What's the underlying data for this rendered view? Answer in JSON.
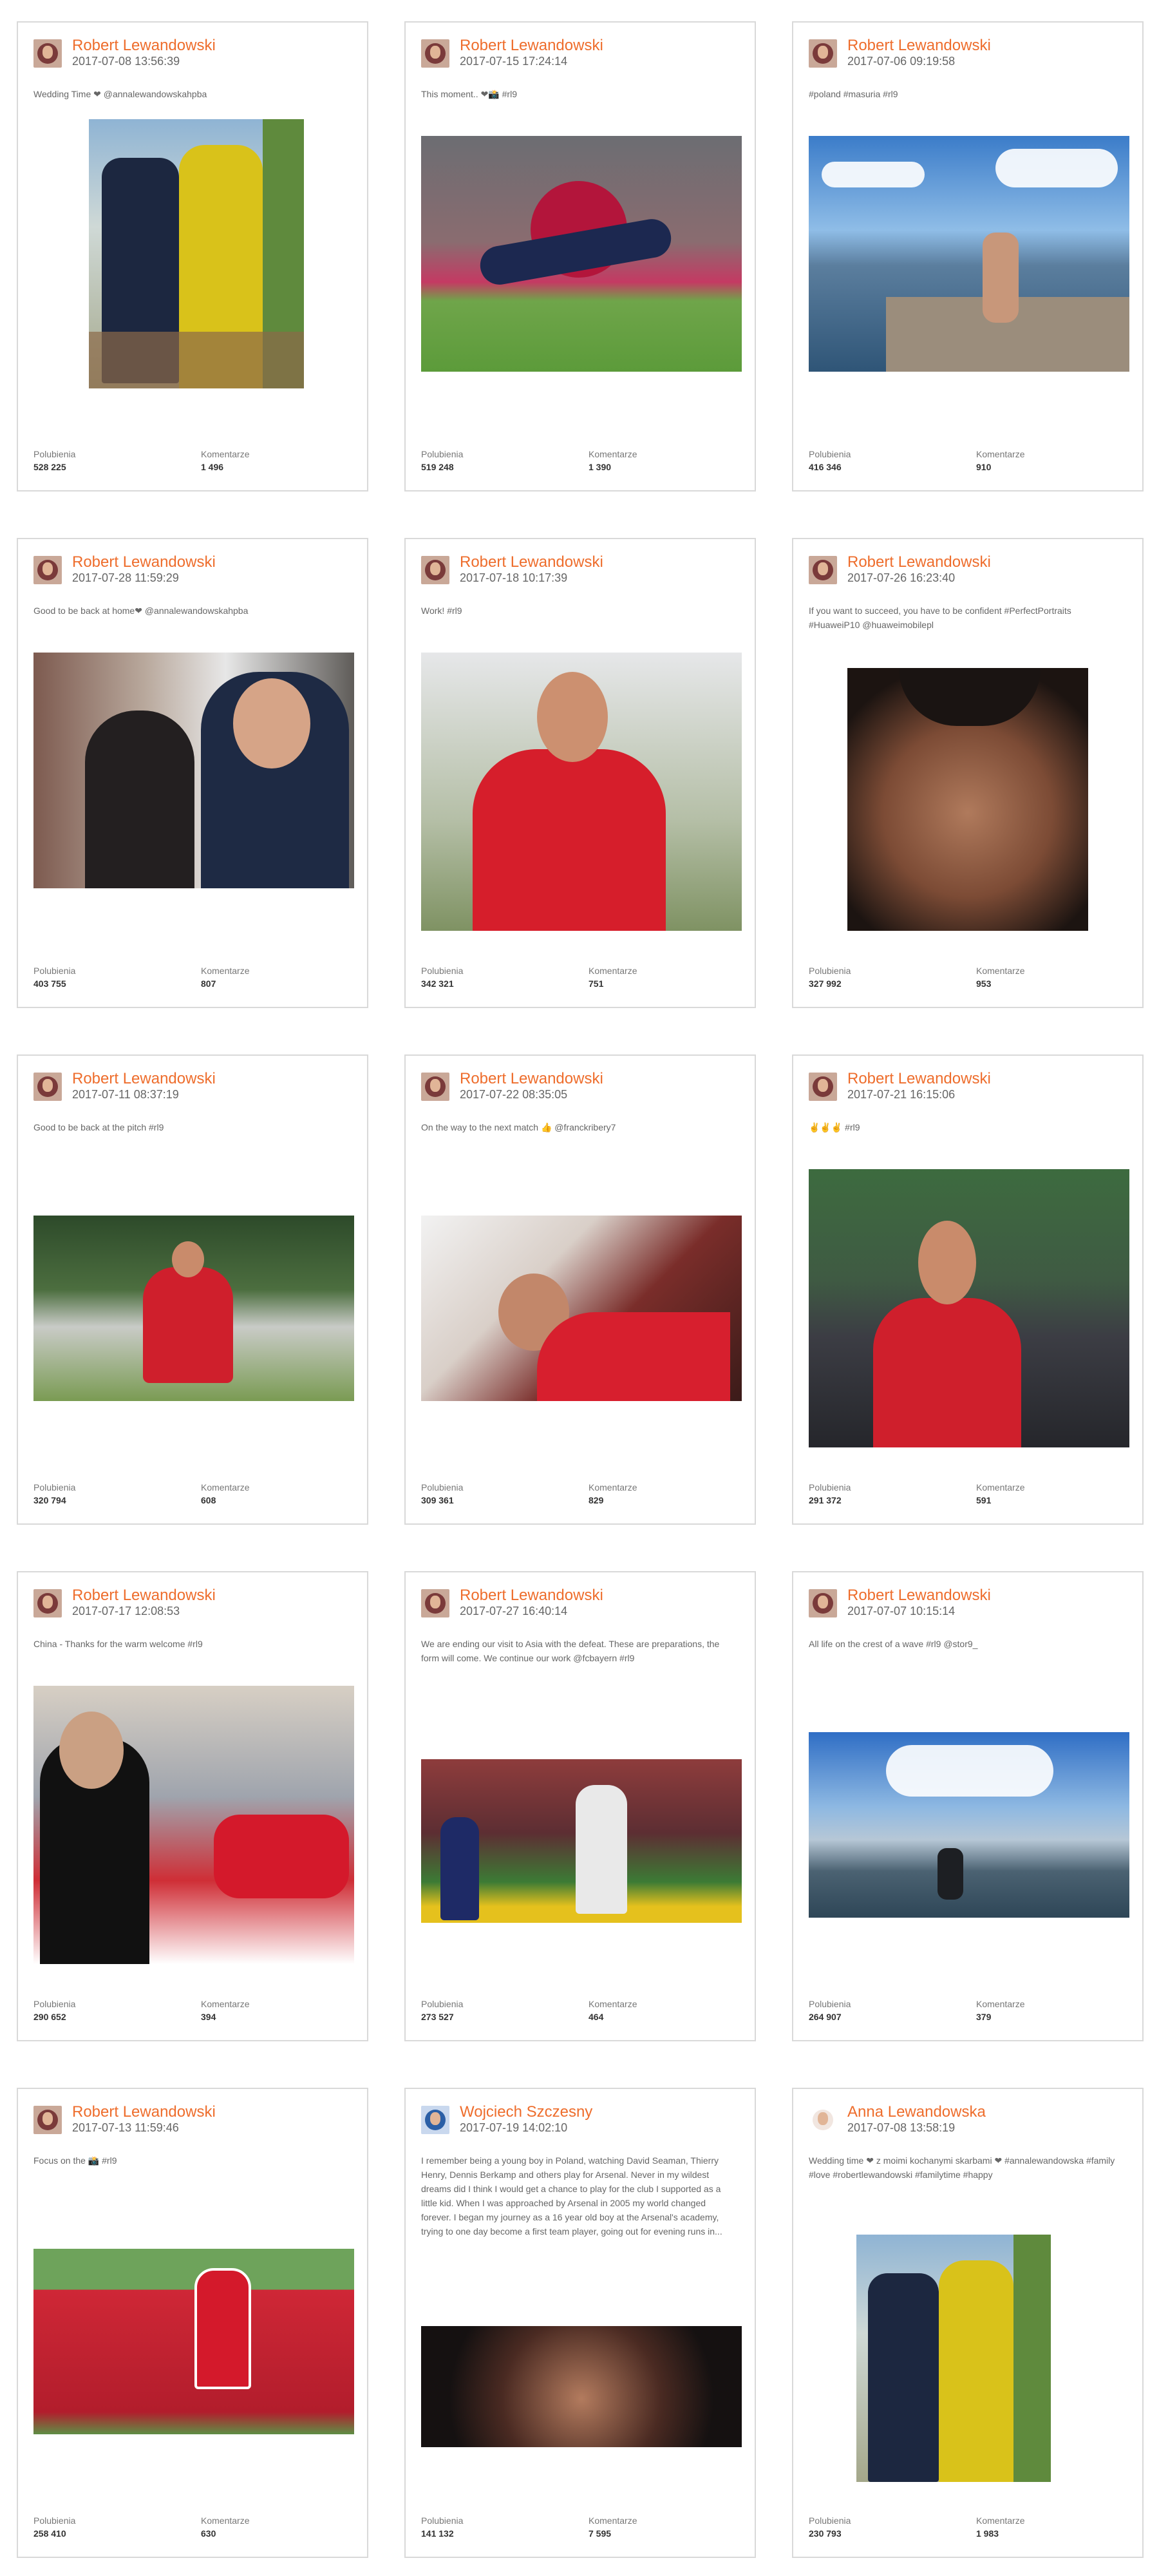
{
  "labels": {
    "likes": "Polubienia",
    "comments": "Komentarze"
  },
  "posts": [
    {
      "author": "Robert Lewandowski",
      "date": "2017-07-08 13:56:39",
      "caption": "Wedding Time ❤ @annalewandowskahpba",
      "likes": "528 225",
      "comments": "1 496",
      "avatar": "rl-avatar"
    },
    {
      "author": "Robert Lewandowski",
      "date": "2017-07-15 17:24:14",
      "caption": "This moment.. ❤📸 #rl9",
      "likes": "519 248",
      "comments": "1 390",
      "avatar": "rl-avatar"
    },
    {
      "author": "Robert Lewandowski",
      "date": "2017-07-06 09:19:58",
      "caption": "#poland #masuria #rl9",
      "likes": "416 346",
      "comments": "910",
      "avatar": "rl-avatar"
    },
    {
      "author": "Robert Lewandowski",
      "date": "2017-07-28 11:59:29",
      "caption": "Good to be back at home❤ @annalewandowskahpba",
      "likes": "403 755",
      "comments": "807",
      "avatar": "rl-avatar"
    },
    {
      "author": "Robert Lewandowski",
      "date": "2017-07-18 10:17:39",
      "caption": "Work! #rl9",
      "likes": "342 321",
      "comments": "751",
      "avatar": "rl-avatar"
    },
    {
      "author": "Robert Lewandowski",
      "date": "2017-07-26 16:23:40",
      "caption": "If you want to succeed, you have to be confident #PerfectPortraits #HuaweiP10 @huaweimobilepl",
      "likes": "327 992",
      "comments": "953",
      "avatar": "rl-avatar"
    },
    {
      "author": "Robert Lewandowski",
      "date": "2017-07-11 08:37:19",
      "caption": "Good to be back at the pitch #rl9",
      "likes": "320 794",
      "comments": "608",
      "avatar": "rl-avatar"
    },
    {
      "author": "Robert Lewandowski",
      "date": "2017-07-22 08:35:05",
      "caption": "On the way to the next match 👍 @franckribery7",
      "likes": "309 361",
      "comments": "829",
      "avatar": "rl-avatar"
    },
    {
      "author": "Robert Lewandowski",
      "date": "2017-07-21 16:15:06",
      "caption": "✌️✌️✌️ #rl9",
      "likes": "291 372",
      "comments": "591",
      "avatar": "rl-avatar"
    },
    {
      "author": "Robert Lewandowski",
      "date": "2017-07-17 12:08:53",
      "caption": "China - Thanks for the warm welcome #rl9",
      "likes": "290 652",
      "comments": "394",
      "avatar": "rl-avatar"
    },
    {
      "author": "Robert Lewandowski",
      "date": "2017-07-27 16:40:14",
      "caption": "We are ending our visit to Asia with the defeat. These are preparations, the form will come. We continue our work @fcbayern #rl9",
      "likes": "273 527",
      "comments": "464",
      "avatar": "rl-avatar"
    },
    {
      "author": "Robert Lewandowski",
      "date": "2017-07-07 10:15:14",
      "caption": "All life on the crest of a wave #rl9 @stor9_",
      "likes": "264 907",
      "comments": "379",
      "avatar": "rl-avatar"
    },
    {
      "author": "Robert Lewandowski",
      "date": "2017-07-13 11:59:46",
      "caption": "Focus on the 📸 #rl9",
      "likes": "258 410",
      "comments": "630",
      "avatar": "rl-avatar"
    },
    {
      "author": "Wojciech Szczesny",
      "date": "2017-07-19 14:02:10",
      "caption": "I remember being a young boy in Poland, watching David Seaman, Thierry Henry, Dennis Berkamp and others play for Arsenal. Never in my wildest dreams did I think I would get a chance to play for the club I supported as a little kid. When I was approached by Arsenal in 2005 my world changed forever. I began my journey as a 16 year old boy at the Arsenal's academy, trying to one day become a first team player, going out for evening runs in...",
      "likes": "141 132",
      "comments": "7 595",
      "avatar": "ws-avatar"
    },
    {
      "author": "Anna Lewandowska",
      "date": "2017-07-08 13:58:19",
      "caption": "Wedding time ❤ z moimi kochanymi skarbami ❤ #annalewandowska #family #love #robertlewandowski #familytime #happy",
      "likes": "230 793",
      "comments": "1 983",
      "avatar": "al-avatar"
    }
  ]
}
